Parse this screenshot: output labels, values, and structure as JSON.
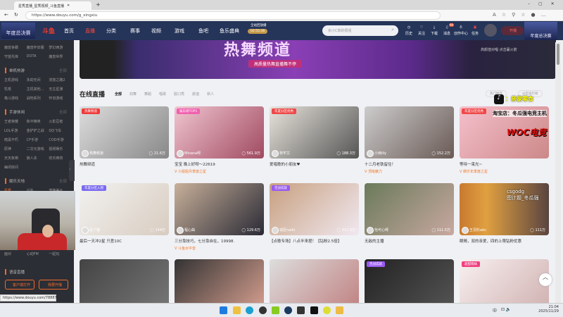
{
  "browser": {
    "tab_title": "星秀直播_星秀视频_斗鱼直播",
    "url": "https://www.douyu.com/g_xingxiu",
    "status_url": "https://www.douyu.com/7888746"
  },
  "header": {
    "brand_banner": "年度总决赛",
    "logo": "斗鱼",
    "nav": [
      "首页",
      "直播",
      "分类",
      "赛事",
      "视频",
      "游戏",
      "鱼吧",
      "鱼乐盛典"
    ],
    "active_nav": "直播",
    "countdown_label": "全站回放播",
    "countdown": "02:55:36",
    "search_placeholder": "余小C真的很强",
    "icons": [
      "历史",
      "关注",
      "下载",
      "消息",
      "创作中心",
      "任务"
    ],
    "message_badge": "99",
    "live_button": "开播",
    "right_banner": "年度总决赛"
  },
  "sidebar": {
    "top_games": [
      "魔兽争霸",
      "魔兽怀旧服",
      "梦幻西游",
      "守望先锋",
      "DOTA",
      "魔兽世界"
    ],
    "sections": [
      {
        "title": "单机热游",
        "more": "全部",
        "items": [
          "主机游戏",
          "永劫无间",
          "流放之路2",
          "饥荒",
          "主机其他...",
          "无主星渊",
          "格斗游戏",
          "战地系列",
          "怀旧游戏"
        ]
      },
      {
        "title": "手游休闲",
        "more": "全部",
        "items": [
          "王者荣耀",
          "和平精英",
          "火影忍者",
          "LOL手游",
          "金铲铲之战",
          "QQ飞车",
          "暗黑不朽",
          "CF手游",
          "COD手游",
          "原神",
          "二次元游戏",
          "视频娱乐",
          "天天象棋",
          "狼人杀",
          "欢乐麻将",
          "幽闭房间"
        ]
      },
      {
        "title": "娱乐天地",
        "more": "全部",
        "items": [
          "星秀",
          "户外",
          "宠萌美女",
          "面对",
          "心动FM",
          "一起玩"
        ]
      }
    ],
    "voice_title": "语音直播",
    "btn_client": "客户端打开",
    "btn_live": "我要开播"
  },
  "banner": {
    "title": "热舞频道",
    "subtitle": "高质量热舞直播舞不停",
    "side_text": "高颜值对唱 点击赢火箭"
  },
  "section": {
    "title": "在线直播",
    "filters": [
      "全部",
      "劲舞",
      "舞蹈",
      "唱歌",
      "脱口秀",
      "颜值",
      "新人"
    ],
    "active_filter": "全部",
    "btn_hot": "热门推荐",
    "btn_rank": "分区排行榜"
  },
  "cards": [
    {
      "badge": "热舞频道",
      "anchor": "热舞频道",
      "views": "21.6万",
      "title": "热舞频道",
      "sub": ""
    },
    {
      "badge": "娱乐榜TOP1",
      "anchor": "Minana呀",
      "views": "561.9万",
      "title": "宝宝 晚上好呀～22619",
      "sub": "小姐姐月季度之星"
    },
    {
      "badge": "年度分区优秀",
      "anchor": "林芊艾",
      "views": "188.3万",
      "title": "爱唱歌的小朋友♥",
      "sub": ""
    },
    {
      "badge": "",
      "anchor": "小雨lily",
      "views": "152.2万",
      "title": "十二月老铁留住！",
      "sub": "顶级魅力"
    },
    {
      "badge": "年度分区优秀",
      "anchor": "",
      "views": "",
      "title": "等待一束光~",
      "sub": "娱乐年季度之星"
    },
    {
      "badge": "年度分区入围",
      "anchor": "是个猫",
      "views": "144万",
      "title": "最后一天冲2星 只差10C",
      "sub": ""
    },
    {
      "badge": "",
      "anchor": "程心曲",
      "views": "129.6万",
      "title": "三分靠技巧，七分靠自在，19998.",
      "sub": "斗鱼女中音"
    },
    {
      "badge": "百战成就",
      "anchor": "钱臣nado",
      "views": "317.9万",
      "title": "【点歌专场】八点半来捏！【钻粉2.5倍】",
      "sub": ""
    },
    {
      "badge": "",
      "anchor": "怡可心呀",
      "views": "111.5万",
      "title": "无敌的主播",
      "sub": ""
    },
    {
      "badge": "",
      "anchor": "王羽杉abc",
      "views": "111万",
      "title": "眼睛，双的亲爱，四的上限钻粉优惠",
      "sub": ""
    },
    {
      "badge": "",
      "anchor": "",
      "views": "",
      "title": "",
      "sub": ""
    },
    {
      "badge": "",
      "anchor": "",
      "views": "",
      "title": "",
      "sub": ""
    },
    {
      "badge": "",
      "anchor": "",
      "views": "",
      "title": "",
      "sub": ""
    },
    {
      "badge": "百战成就",
      "anchor": "",
      "views": "",
      "title": "",
      "sub": ""
    },
    {
      "badge": "超甜萌妹",
      "anchor": "",
      "views": "",
      "title": "",
      "sub": ""
    }
  ],
  "overlay": {
    "douyin": "：亲家零食",
    "taobao": "淘宝店：冬瓜强电竞主机",
    "woc": "WOC电竞",
    "csgo": "csgodg",
    "weibo": "图计题_冬瓜强"
  },
  "taskbar": {
    "time": "21:04",
    "date": "2025/11/29",
    "ime": "中"
  }
}
